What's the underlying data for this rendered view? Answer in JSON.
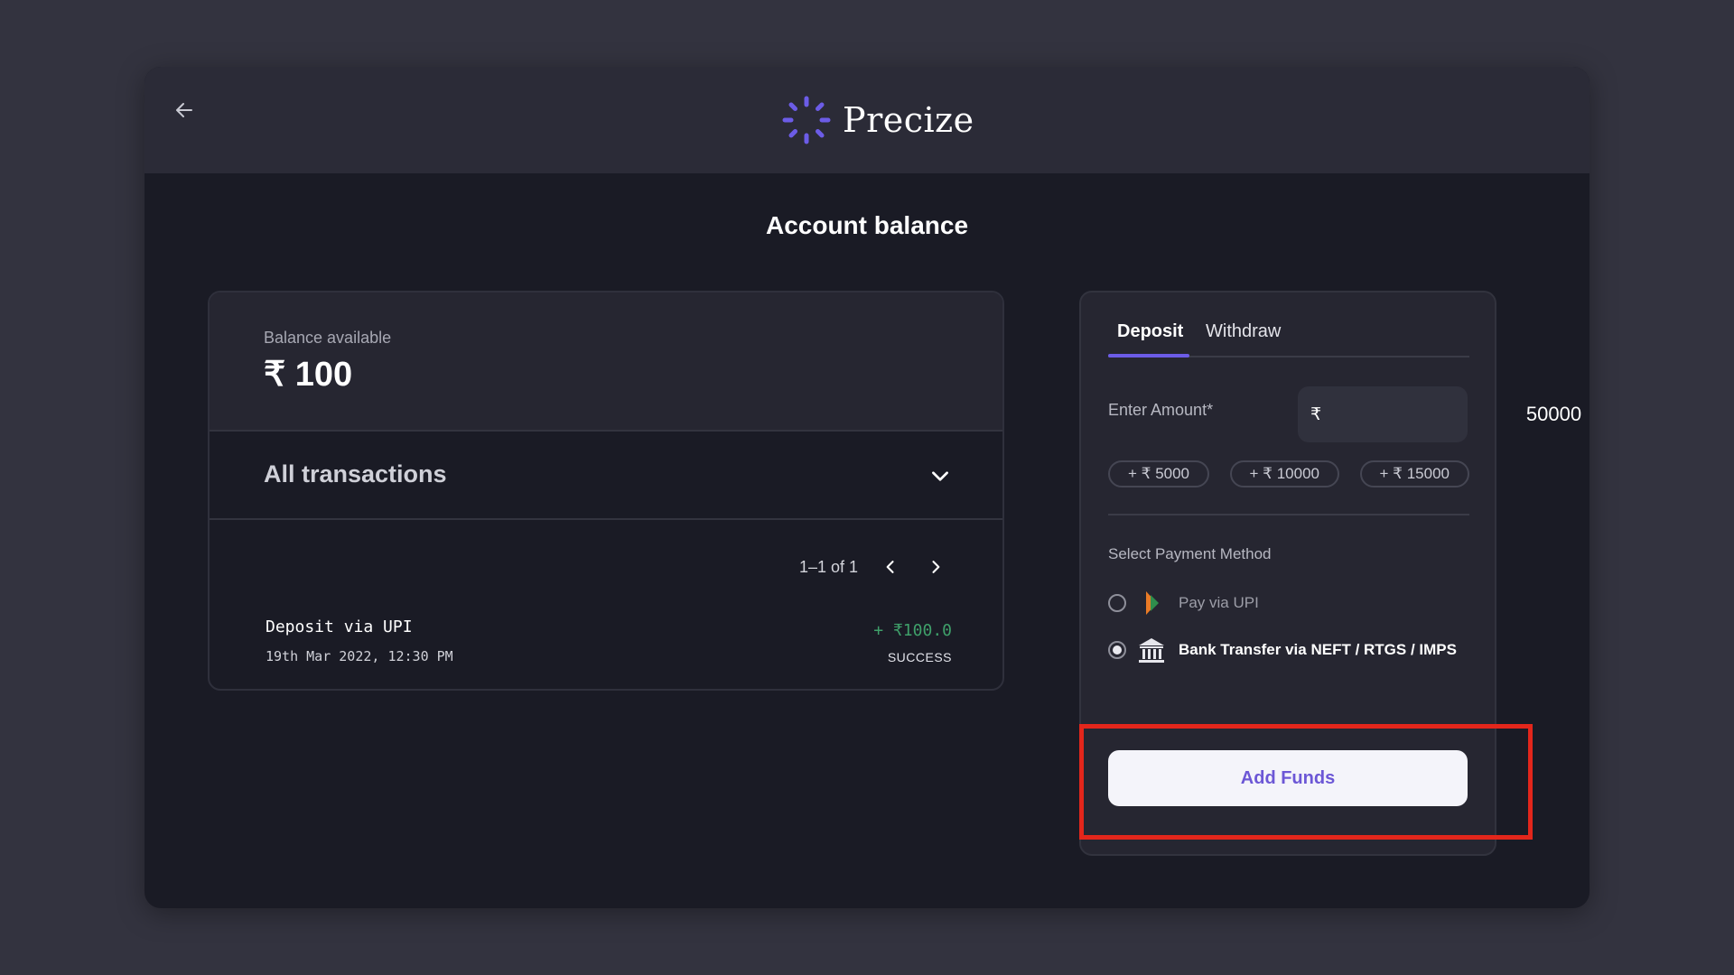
{
  "app": {
    "brand_name": "Precize"
  },
  "page": {
    "title": "Account balance"
  },
  "balance": {
    "label": "Balance available",
    "value": "₹ 100"
  },
  "transactions": {
    "header": "All transactions",
    "pagination": "1–1 of 1",
    "items": [
      {
        "name": "Deposit via UPI",
        "date": "19th Mar 2022, 12:30 PM",
        "amount": "+ ₹100.0",
        "status": "SUCCESS"
      }
    ]
  },
  "funds": {
    "tabs": [
      {
        "label": "Deposit",
        "active": true
      },
      {
        "label": "Withdraw",
        "active": false
      }
    ],
    "amount_label": "Enter Amount*",
    "currency_symbol": "₹",
    "amount_value": "50000",
    "quick_amounts": [
      "+ ₹ 5000",
      "+ ₹ 10000",
      "+ ₹ 15000"
    ],
    "payment_method_label": "Select Payment Method",
    "payment_methods": [
      {
        "label": "Pay via UPI",
        "selected": false,
        "icon": "upi-icon"
      },
      {
        "label": "Bank Transfer via NEFT / RTGS / IMPS",
        "selected": true,
        "icon": "bank-icon"
      }
    ],
    "submit_label": "Add Funds"
  },
  "colors": {
    "accent": "#6c5ce7",
    "success": "#3fa06a",
    "highlight": "#e3261b"
  }
}
